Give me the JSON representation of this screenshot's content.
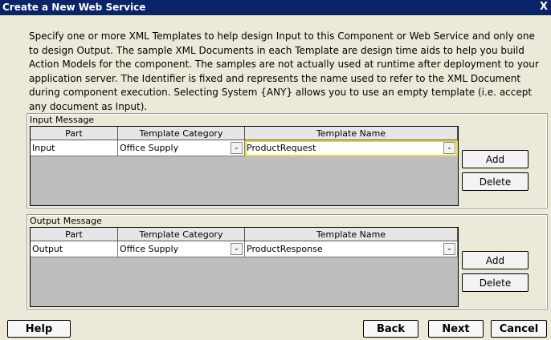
{
  "window": {
    "title": "Create a New Web Service",
    "close_glyph": "X"
  },
  "description": "Specify one or more XML Templates to help design Input to this Component or Web Service and only one to design Output.  The sample XML Documents in each Template are design time aids to help you build Action Models for the component.  The samples are not actually used at runtime after deployment to your application server.  The Identifier is fixed and represents the name used to refer to the XML Document during component execution.  Selecting System {ANY} allows you to use an empty template (i.e. accept any document as Input).",
  "input": {
    "title": "Input Message",
    "columns": [
      "Part",
      "Template Category",
      "Template Name"
    ],
    "row": {
      "part": "Input",
      "category": "Office Supply",
      "template": "ProductRequest"
    },
    "add_label": "Add",
    "delete_label": "Delete"
  },
  "output": {
    "title": "Output Message",
    "columns": [
      "Part",
      "Template Category",
      "Template Name"
    ],
    "row": {
      "part": "Output",
      "category": "Office Supply",
      "template": "ProductResponse"
    },
    "add_label": "Add",
    "delete_label": "Delete"
  },
  "footer": {
    "help": "Help",
    "back": "Back",
    "next": "Next",
    "cancel": "Cancel"
  },
  "icons": {
    "dropdown": "chevron-down-icon"
  },
  "colors": {
    "titlebar": "#0a246a",
    "highlight": "#e7d94a"
  }
}
